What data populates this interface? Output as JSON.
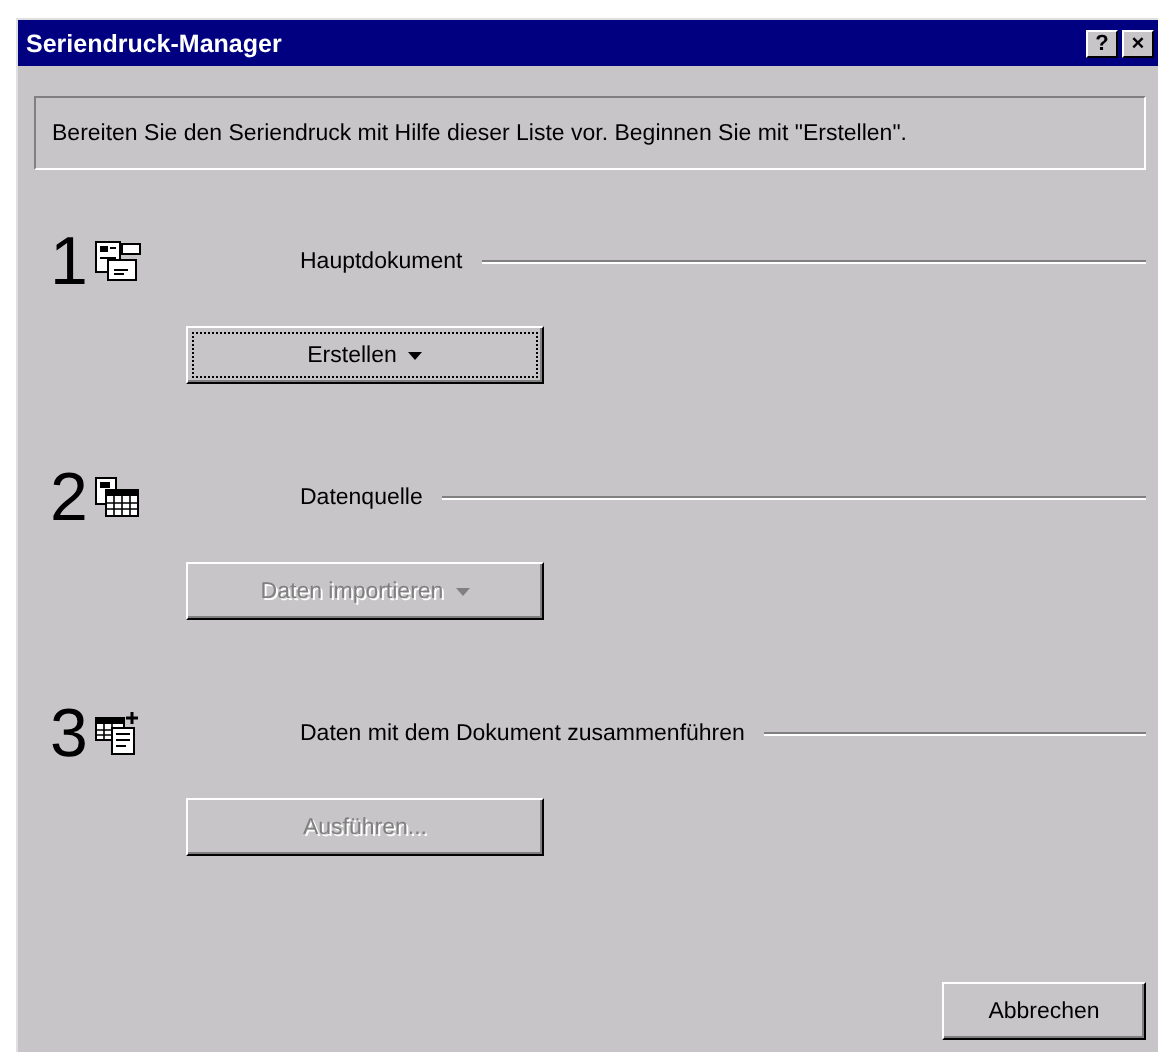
{
  "window": {
    "title": "Seriendruck-Manager",
    "help_button": "?",
    "close_button": "×"
  },
  "instructions": "Bereiten Sie den Seriendruck mit Hilfe dieser Liste vor. Beginnen Sie mit \"Erstellen\".",
  "steps": [
    {
      "number": "1",
      "kind": "document",
      "label": "Hauptdokument",
      "button": {
        "label": "Erstellen",
        "dropdown": true,
        "disabled": false,
        "focused": true
      }
    },
    {
      "number": "2",
      "kind": "datasource",
      "label": "Datenquelle",
      "button": {
        "label": "Daten importieren",
        "dropdown": true,
        "disabled": true,
        "focused": false
      }
    },
    {
      "number": "3",
      "kind": "merge",
      "label": "Daten mit dem Dokument zusammenführen",
      "button": {
        "label": "Ausführen...",
        "dropdown": false,
        "disabled": true,
        "focused": false
      }
    }
  ],
  "cancel_button": "Abbrechen"
}
